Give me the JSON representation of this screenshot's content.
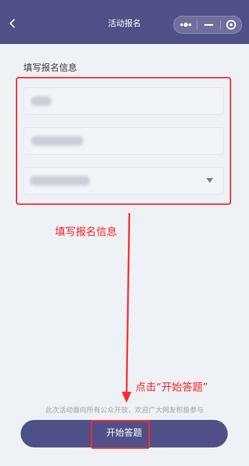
{
  "header": {
    "title": "活动报名",
    "back_icon": "chevron-left-icon",
    "menu_icon": "more-dots-icon",
    "minimize_icon": "minimize-icon",
    "close_icon": "target-close-icon"
  },
  "form": {
    "section_title": "填写报名信息",
    "fields": [
      {
        "type": "text",
        "value": "(redacted)"
      },
      {
        "type": "text",
        "value": "(redacted)"
      },
      {
        "type": "select",
        "value": "(redacted)",
        "icon": "dropdown-arrow-icon"
      }
    ]
  },
  "annotations": {
    "form_hint": "填写报名信息",
    "button_hint": "点击“开始答题”"
  },
  "footer": {
    "note": "此次活动面向所有公众开放，欢迎广大网友积极参与",
    "start_button_label": "开始答题"
  },
  "colors": {
    "brand": "#4f5087",
    "highlight": "#ff2a2a",
    "background": "#eef2f6"
  }
}
